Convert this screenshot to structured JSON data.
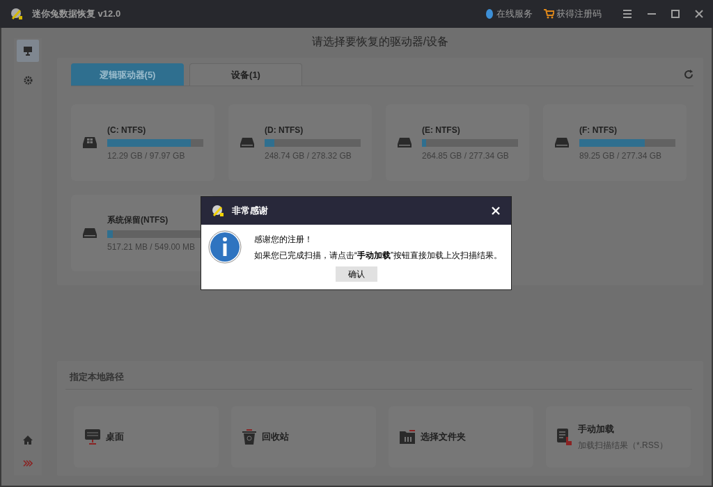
{
  "window": {
    "title": "迷你兔数据恢复 v12.0"
  },
  "header_links": [
    {
      "kind": "service",
      "label": "在线服务"
    },
    {
      "kind": "cart",
      "label": "获得注册码"
    }
  ],
  "sidebar": [
    {
      "kind": "drives",
      "selected": true
    },
    {
      "kind": "settings",
      "selected": false
    }
  ],
  "page_title": "请选择要恢复的驱动器/设备",
  "tabs": [
    {
      "label": "逻辑驱动器(5)",
      "selected": true
    },
    {
      "label": "设备(1)",
      "selected": false
    }
  ],
  "drives": [
    {
      "kind": "windows",
      "name": "(C: NTFS)",
      "level": 0.87,
      "size": "12.29 GB / 97.97 GB"
    },
    {
      "kind": "disk",
      "name": "(D: NTFS)",
      "level": 0.1,
      "size": "248.74 GB / 278.32 GB"
    },
    {
      "kind": "disk",
      "name": "(E: NTFS)",
      "level": 0.045,
      "size": "264.85 GB / 277.34 GB"
    },
    {
      "kind": "disk",
      "name": "(F: NTFS)",
      "level": 0.68,
      "size": "89.25 GB / 277.34 GB"
    },
    {
      "kind": "disk",
      "name": "系统保留(NTFS)",
      "level": 0.06,
      "size": "517.21 MB / 549.00 MB"
    }
  ],
  "local_path": {
    "title": "指定本地路径",
    "items": [
      {
        "kind": "desktop",
        "label": "桌面"
      },
      {
        "kind": "recycle",
        "label": "回收站"
      },
      {
        "kind": "folder",
        "label": "选择文件夹"
      },
      {
        "kind": "load",
        "label": "手动加载",
        "sub": "加载扫描结果（*.RSS）"
      }
    ]
  },
  "dialog": {
    "title": "非常感谢",
    "lines": [
      "感谢您的注册！",
      "如果您已完成扫描，请点击“**手动加载**”按钮直接加载上次扫描结果。"
    ],
    "button": "确认"
  }
}
